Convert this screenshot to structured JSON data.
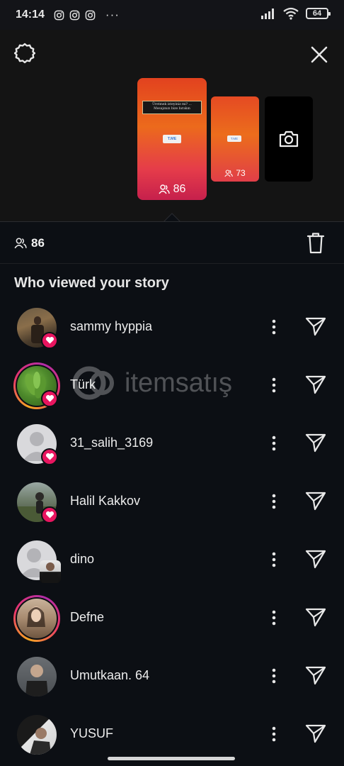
{
  "status_bar": {
    "time": "14:14",
    "notification_icons": [
      "instagram-icon",
      "instagram-icon",
      "instagram-icon"
    ],
    "more": "···",
    "battery": "64"
  },
  "story_preview": {
    "main_story": {
      "banner_text": "Üretmek isteyiniz mi? ... Mesajınızı bize bırakın",
      "link_label": "T.ME",
      "viewers": "86"
    },
    "second_story": {
      "link_label": "T.ME",
      "viewers": "73"
    }
  },
  "summary": {
    "viewers": "86"
  },
  "section_title": "Who viewed your story",
  "viewers": [
    {
      "name": "sammy hyppia",
      "liked": true,
      "ring": false
    },
    {
      "name": "Türk",
      "liked": true,
      "ring": true
    },
    {
      "name": "31_salih_3169",
      "liked": true,
      "ring": false
    },
    {
      "name": "Halil Kakkov",
      "liked": true,
      "ring": false
    },
    {
      "name": "dino",
      "liked": false,
      "ring": false
    },
    {
      "name": "Defne",
      "liked": false,
      "ring": true
    },
    {
      "name": "Umutkaan. 64",
      "liked": false,
      "ring": false
    },
    {
      "name": "YUSUF",
      "liked": false,
      "ring": false
    }
  ],
  "colors": {
    "background": "#0c0f14",
    "heart_badge": "#e8155f",
    "story_gradient_top": "#e2421f",
    "story_gradient_bottom": "#c6204c"
  },
  "watermark": "itemsatış"
}
